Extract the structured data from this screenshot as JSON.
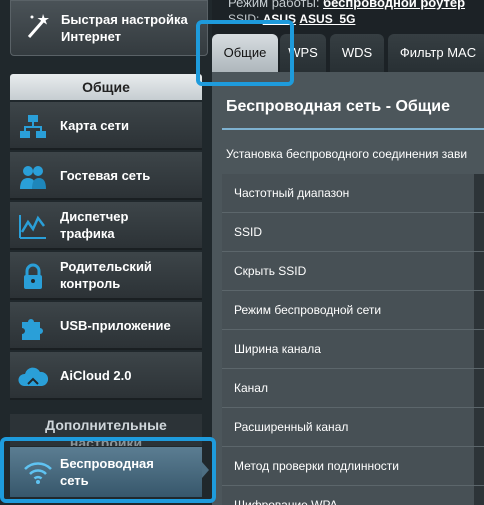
{
  "sidebar": {
    "quick_setup": {
      "line1": "Быстрая настройка",
      "line2": "Интернет"
    },
    "general_header": "Общие",
    "items": [
      {
        "line1": "Карта сети",
        "line2": "",
        "icon": "network-map-icon"
      },
      {
        "line1": "Гостевая сеть",
        "line2": "",
        "icon": "guest-network-icon"
      },
      {
        "line1": "Диспетчер",
        "line2": "трафика",
        "icon": "traffic-manager-icon"
      },
      {
        "line1": "Родительский",
        "line2": "контроль",
        "icon": "parental-lock-icon"
      },
      {
        "line1": "USB-приложение",
        "line2": "",
        "icon": "puzzle-icon"
      },
      {
        "line1": "AiCloud 2.0",
        "line2": "",
        "icon": "cloud-icon"
      }
    ],
    "advanced_header": {
      "line1": "Дополнительные",
      "line2": "настройки"
    },
    "wireless": {
      "line1": "Беспроводная",
      "line2": "сеть",
      "icon": "wifi-icon"
    }
  },
  "status": {
    "mode_label": "Режим работы:",
    "mode_value": "беспроводной роутер",
    "ssid_label": "SSID:",
    "ssid_value1": "ASUS",
    "ssid_value2": "ASUS_5G"
  },
  "tabs": [
    "Общие",
    "WPS",
    "WDS",
    "Фильтр MAC"
  ],
  "panel": {
    "title": "Беспроводная сеть - Общие",
    "description": "Установка беспроводного соединения зави",
    "rows": [
      "Частотный диапазон",
      "SSID",
      "Скрыть SSID",
      "Режим беспроводной сети",
      "Ширина канала",
      "Канал",
      "Расширенный канал",
      "Метод проверки подлинности",
      "Шифрование WPA"
    ]
  },
  "colors": {
    "highlight": "#1e9bdc",
    "accent_line": "#7eb1d0",
    "active_menu": "#4b6d82"
  }
}
